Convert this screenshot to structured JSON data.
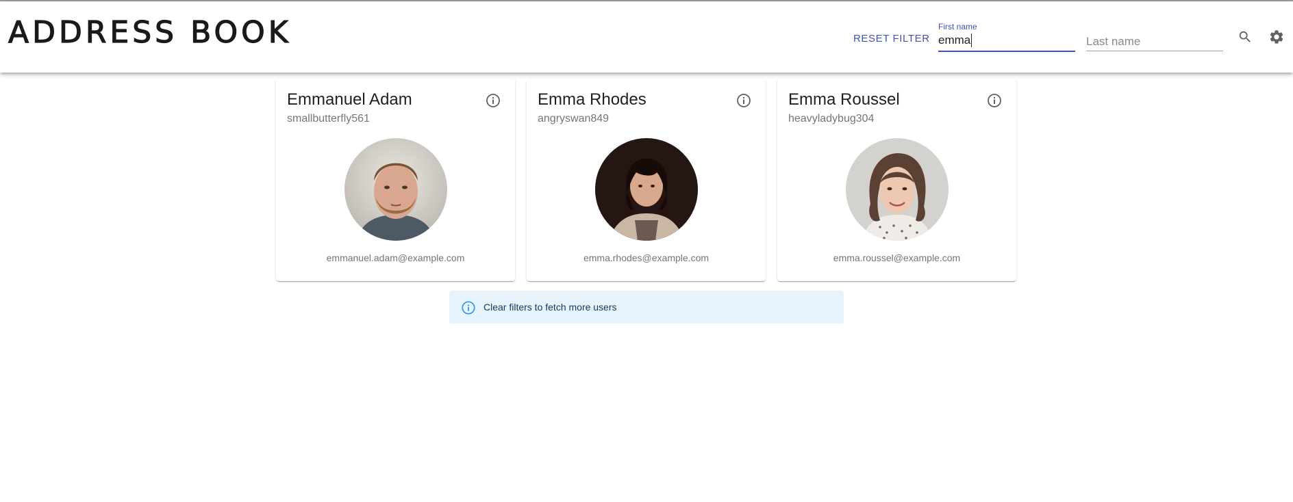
{
  "app": {
    "title": "ADDRESS BOOK"
  },
  "toolbar": {
    "reset_label": "RESET FILTER",
    "first_name": {
      "label": "First name",
      "value": "emma"
    },
    "last_name": {
      "placeholder": "Last name",
      "value": ""
    },
    "search_icon": "search-icon",
    "settings_icon": "gear-icon"
  },
  "users": [
    {
      "name": "Emmanuel Adam",
      "username": "smallbutterfly561",
      "email": "emmanuel.adam@example.com"
    },
    {
      "name": "Emma Rhodes",
      "username": "angryswan849",
      "email": "emma.rhodes@example.com"
    },
    {
      "name": "Emma Roussel",
      "username": "heavyladybug304",
      "email": "emma.roussel@example.com"
    }
  ],
  "alert": {
    "text": "Clear filters to fetch more users",
    "icon": "info-icon"
  },
  "colors": {
    "primary": "#3f51b5",
    "alert_bg": "#e8f4fd",
    "alert_icon": "#2196f3"
  }
}
